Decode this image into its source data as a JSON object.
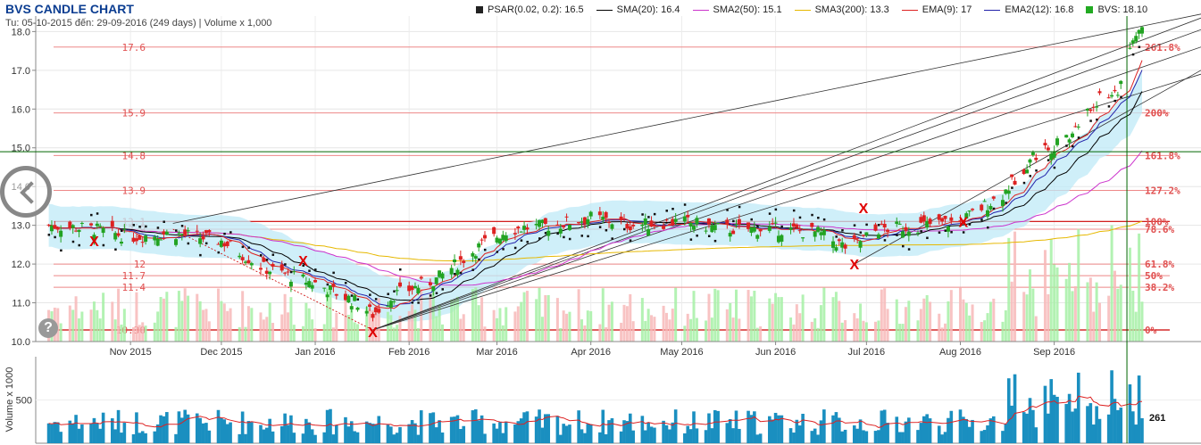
{
  "header": {
    "title": "BVS CANDLE CHART",
    "subtitle": "Tu: 05-10-2015 đến: 29-09-2016 (249 days) | Volume x 1,000"
  },
  "legend": [
    {
      "label": "PSAR(0.02, 0.2): 16.5",
      "color": "#222222",
      "kind": "square"
    },
    {
      "label": "SMA(20): 16.4",
      "color": "#000000",
      "kind": "line"
    },
    {
      "label": "SMA2(50): 15.1",
      "color": "#cc33cc",
      "kind": "line"
    },
    {
      "label": "SMA3(200): 13.3",
      "color": "#e6b800",
      "kind": "line"
    },
    {
      "label": "EMA(9): 17",
      "color": "#dd2222",
      "kind": "line"
    },
    {
      "label": "EMA2(12): 16.8",
      "color": "#2222aa",
      "kind": "line"
    },
    {
      "label": "BVS: 18.10",
      "color": "#22aa22",
      "kind": "square"
    }
  ],
  "icons": {
    "back": "back-arrow-icon",
    "help": "help-icon"
  },
  "colors": {
    "up": "#22a322",
    "down": "#dd2222",
    "band": "#bfe9f7",
    "fibo": "#e88",
    "up_vol": "#a6f0a6",
    "down_vol": "#f7b8b8",
    "vol_bar": "#1a8fc0"
  },
  "chart_data": {
    "type": "candlestick",
    "title": "BVS CANDLE CHART",
    "ylim": [
      10.0,
      18.4
    ],
    "yticks": [
      "10.0",
      "11.0",
      "12.0",
      "13.0",
      "14.0",
      "15.0",
      "16.0",
      "17.0",
      "18.0"
    ],
    "xticks": [
      "Nov 2015",
      "Dec 2015",
      "Jan 2016",
      "Feb 2016",
      "Mar 2016",
      "Apr 2016",
      "May 2016",
      "Jun 2016",
      "Jul 2016",
      "Aug 2016",
      "Sep 2016"
    ],
    "fibonacci": [
      {
        "price": 17.6,
        "left": "17.6",
        "right": "261.8%"
      },
      {
        "price": 15.9,
        "left": "15.9",
        "right": "200%"
      },
      {
        "price": 14.8,
        "left": "14.8",
        "right": "161.8%"
      },
      {
        "price": 13.9,
        "left": "13.9",
        "right": "127.2%"
      },
      {
        "price": 13.1,
        "left": "13.1",
        "right": "100%"
      },
      {
        "price": 12.9,
        "left": "12.9",
        "right": "78.6%"
      },
      {
        "price": 12.0,
        "left": "12",
        "right": "61.8%"
      },
      {
        "price": 11.7,
        "left": "11.7",
        "right": "50%"
      },
      {
        "price": 11.4,
        "left": "11.4",
        "right": "38.2%"
      },
      {
        "price": 10.3,
        "left": "10.30",
        "right": "0%"
      }
    ],
    "price_path": [
      [
        "2015-10-05",
        13.0
      ],
      [
        "2015-10-20",
        12.9
      ],
      [
        "2015-11-01",
        12.7
      ],
      [
        "2015-11-15",
        12.8
      ],
      [
        "2015-12-01",
        12.6
      ],
      [
        "2015-12-15",
        11.9
      ],
      [
        "2016-01-01",
        11.5
      ],
      [
        "2016-01-15",
        11.0
      ],
      [
        "2016-01-20",
        10.7
      ],
      [
        "2016-01-27",
        11.2
      ],
      [
        "2016-02-10",
        11.6
      ],
      [
        "2016-02-25",
        12.5
      ],
      [
        "2016-03-05",
        12.9
      ],
      [
        "2016-03-20",
        13.0
      ],
      [
        "2016-04-01",
        13.2
      ],
      [
        "2016-04-15",
        13.0
      ],
      [
        "2016-05-01",
        13.1
      ],
      [
        "2016-05-15",
        12.9
      ],
      [
        "2016-06-01",
        12.9
      ],
      [
        "2016-06-15",
        12.8
      ],
      [
        "2016-06-25",
        12.4
      ],
      [
        "2016-07-05",
        12.9
      ],
      [
        "2016-07-20",
        13.0
      ],
      [
        "2016-08-01",
        13.1
      ],
      [
        "2016-08-15",
        13.8
      ],
      [
        "2016-08-25",
        14.8
      ],
      [
        "2016-09-05",
        15.2
      ],
      [
        "2016-09-15",
        16.2
      ],
      [
        "2016-09-22",
        16.5
      ],
      [
        "2016-09-29",
        18.1
      ]
    ],
    "sar_signals": [
      {
        "date": "2015-10-20",
        "price": 12.6,
        "label": "X"
      },
      {
        "date": "2015-12-28",
        "price": 12.1,
        "label": "X"
      },
      {
        "date": "2016-01-20",
        "price": 10.25,
        "label": "X"
      },
      {
        "date": "2016-06-27",
        "price": 12.0,
        "label": "X"
      },
      {
        "date": "2016-06-30",
        "price": 13.45,
        "label": "X"
      },
      {
        "date": "2016-08-02",
        "price": 13.1,
        "label": "X"
      }
    ],
    "crosshair": {
      "date": "2016-09-25",
      "price": 14.9
    },
    "volume": {
      "ylabel": "Volume x 1000",
      "ytick": "500",
      "last_label": "261",
      "ylim": [
        0,
        1000
      ]
    }
  }
}
